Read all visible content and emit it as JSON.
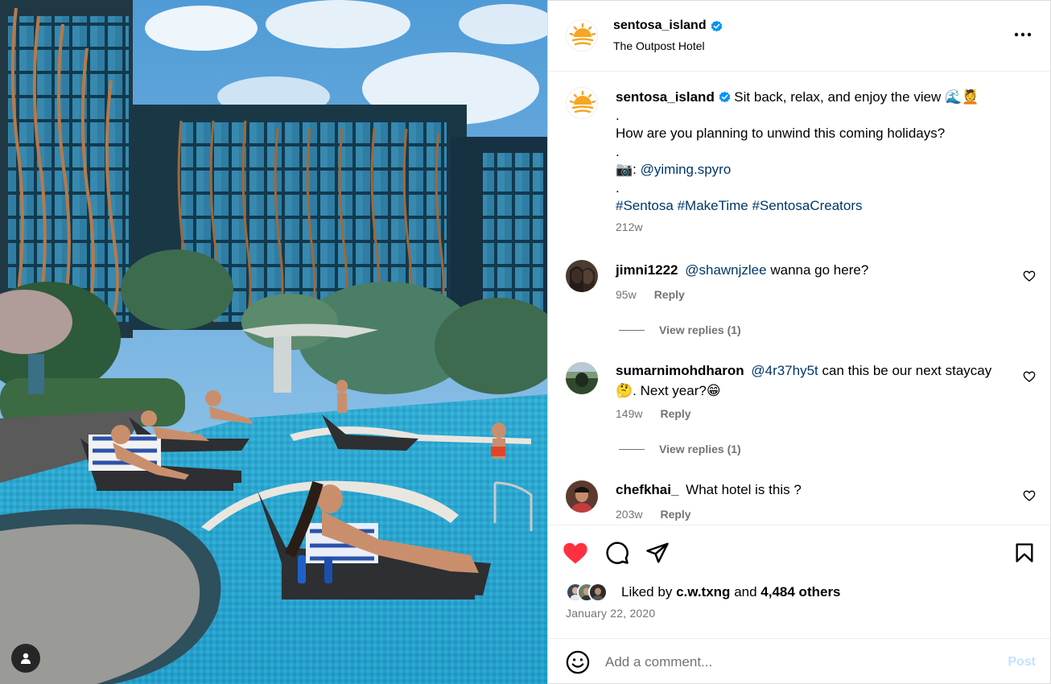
{
  "post": {
    "username": "sentosa_island",
    "location": "The Outpost Hotel",
    "caption": {
      "line1": "Sit back, relax, and enjoy the view 🌊💆",
      "dot1": ".",
      "line2": "How are you planning to unwind this coming holidays?",
      "dot2": ".",
      "camera": "📷:",
      "credit": "@yiming.spyro",
      "dot3": ".",
      "hashtags": [
        "#Sentosa",
        "#MakeTime",
        "#SentosaCreators"
      ],
      "time": "212w"
    },
    "comments": [
      {
        "username": "jimni1222",
        "mention": "@shawnjzlee",
        "text": "wanna go here?",
        "time": "95w",
        "reply_label": "Reply",
        "view_replies": "View replies (1)"
      },
      {
        "username": "sumarnimohdharon",
        "mention": "@4r37hy5t",
        "text": "can this be our next staycay",
        "text2": "🤔. Next year?😁",
        "time": "149w",
        "reply_label": "Reply",
        "view_replies": "View replies (1)"
      },
      {
        "username": "chefkhai_",
        "mention": "",
        "text": "What hotel is this ?",
        "time": "203w",
        "reply_label": "Reply"
      }
    ],
    "likes": {
      "prefix": "Liked by",
      "user": "c.w.txng",
      "and": "and",
      "others": "4,484 others"
    },
    "date": "January 22, 2020",
    "comment_box": {
      "placeholder": "Add a comment...",
      "post_label": "Post"
    }
  },
  "icons": {
    "more": "more-options-icon",
    "like": "heart-filled-icon",
    "comment": "comment-bubble-icon",
    "share": "paper-plane-icon",
    "save": "bookmark-icon",
    "emoji": "smiley-icon",
    "verified": "verified-badge-icon",
    "user": "user-silhouette-icon"
  },
  "colors": {
    "like_red": "#ff3040",
    "verified_blue": "#0095f6",
    "link_blue": "#00376b",
    "muted": "#737373",
    "post_disabled": "#c7e0fd",
    "brand_orange": "#f5a623"
  }
}
